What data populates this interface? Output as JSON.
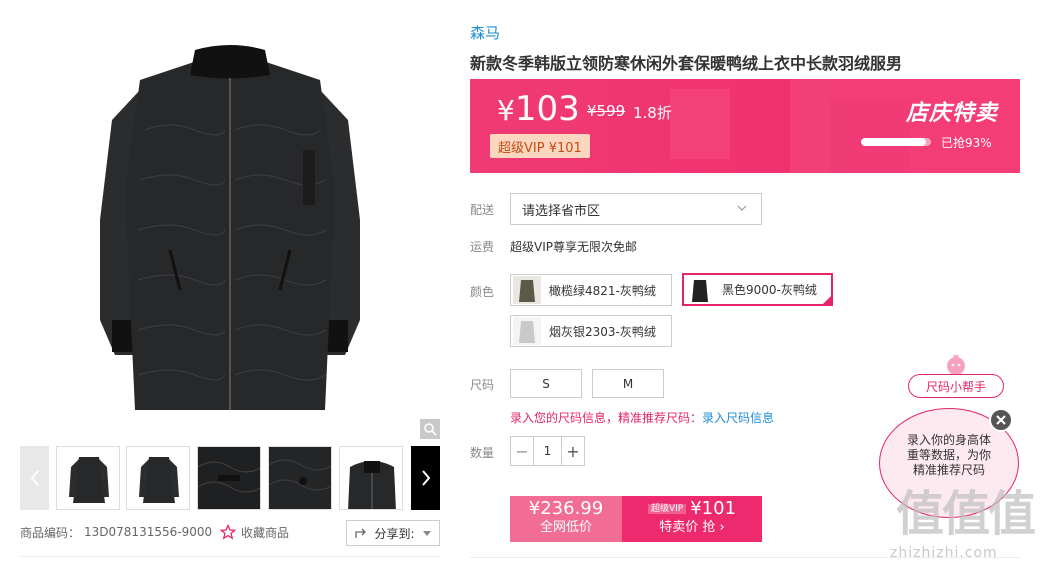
{
  "product": {
    "brand": "森马",
    "title": "新款冬季韩版立领防寒休闲外套保暖鸭绒上衣中长款羽绒服男",
    "sku_label": "商品编码：",
    "sku": "13D078131556-9000",
    "favorite_label": "收藏商品",
    "share_label": "分享到:"
  },
  "price_box": {
    "yen": "¥",
    "price": "103",
    "original_price": "¥599",
    "discount": "1.8折",
    "vip_label": "超级VIP ¥101",
    "promo_title": "店庆特卖",
    "progress_text": "已抢93%",
    "progress_fraction": 0.93
  },
  "delivery": {
    "label": "配送",
    "select_value": "请选择省市区"
  },
  "shipping": {
    "label": "运费",
    "value": "超级VIP尊享无限次免邮"
  },
  "color": {
    "label": "颜色",
    "options": [
      {
        "label": "橄榄绿4821-灰鸭绒",
        "swatch": "#5b5a48"
      },
      {
        "label": "黑色9000-灰鸭绒",
        "swatch": "#222222"
      },
      {
        "label": "烟灰银2303-灰鸭绒",
        "swatch": "#c9c9c9"
      }
    ]
  },
  "size": {
    "label": "尺码",
    "options": [
      "S",
      "M"
    ],
    "hint": "录入您的尺码信息，精准推荐尺码：",
    "hint_link": "录入尺码信息"
  },
  "quantity": {
    "label": "数量",
    "minus": "−",
    "value": "1",
    "plus": "+"
  },
  "buy": {
    "left_price": "¥236.99",
    "left_label": "全网低价",
    "vip_badge": "超级VIP",
    "right_price": "¥101",
    "right_label": "特卖价 抢 ›"
  },
  "helper": {
    "tag": "尺码小帮手",
    "bubble_line1": "录入你的身高体",
    "bubble_line2": "重等数据，为你",
    "bubble_line3": "精准推荐尺码"
  },
  "watermark": {
    "glyphs": "值值值",
    "site": "zhizhizhi.com"
  },
  "colors": {
    "accent": "#e6246b",
    "link": "#1d8dd6",
    "promo_bg": "#f03b74"
  }
}
